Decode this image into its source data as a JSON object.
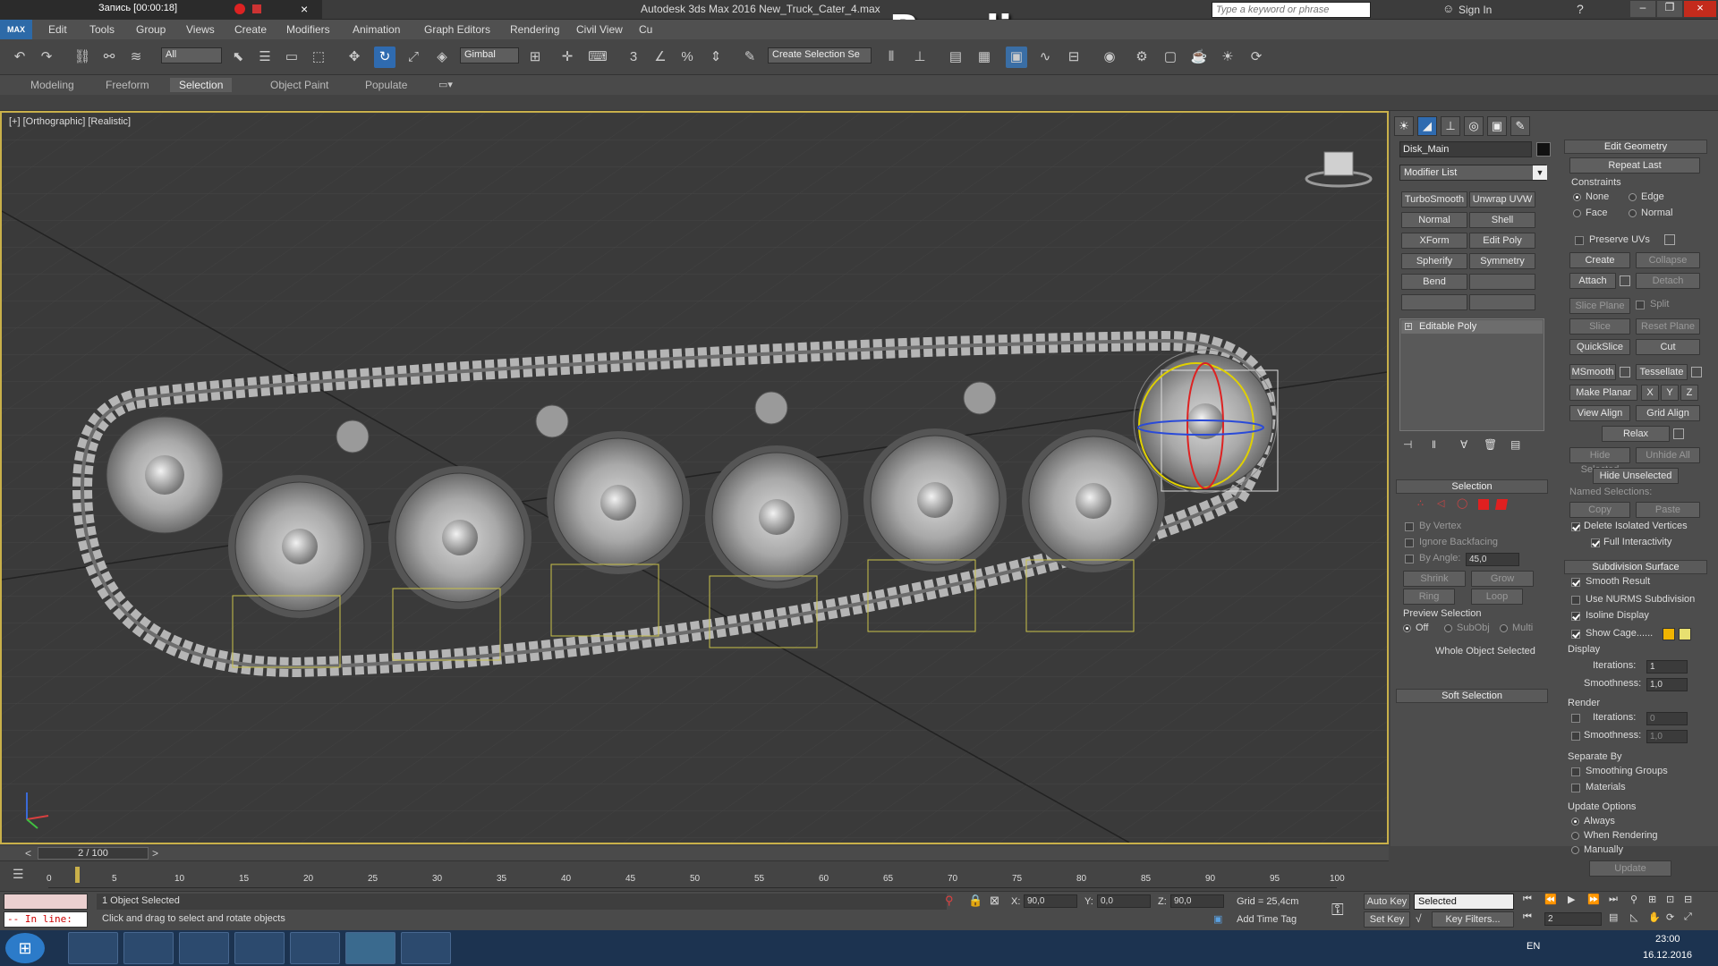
{
  "recorder": {
    "label": "Запись [00:00:18]"
  },
  "window": {
    "title": "Autodesk 3ds Max 2016     New_Truck_Cater_4.max"
  },
  "watermark": "www.Bandicam.com",
  "search": {
    "placeholder": "Type a keyword or phrase"
  },
  "signin": "Sign In",
  "menu": [
    "Edit",
    "Tools",
    "Group",
    "Views",
    "Create",
    "Modifiers",
    "Animation",
    "Graph Editors",
    "Rendering",
    "Civil View",
    "Cu"
  ],
  "app_logo": "MAX",
  "toolbar": {
    "filter": "All",
    "coord": "Gimbal",
    "selection_set": "Create Selection Se"
  },
  "ribbon_tabs": [
    "Modeling",
    "Freeform",
    "Selection",
    "Object Paint",
    "Populate"
  ],
  "ribbon_selected": "Selection",
  "viewport": {
    "label": "[+] [Orthographic] [Realistic]"
  },
  "panel": {
    "object_name": "Disk_Main",
    "modifier_list": "Modifier List",
    "mod_buttons": [
      [
        "TurboSmooth",
        "Unwrap UVW"
      ],
      [
        "Normal",
        "Shell"
      ],
      [
        "XForm",
        "Edit Poly"
      ],
      [
        "Spherify",
        "Symmetry"
      ],
      [
        "Bend",
        ""
      ],
      [
        "",
        ""
      ]
    ],
    "stack_item": "Editable Poly",
    "selection": {
      "title": "Selection",
      "by_vertex": "By Vertex",
      "ignore_backfacing": "Ignore Backfacing",
      "by_angle": "By Angle:",
      "angle_value": "45,0",
      "shrink": "Shrink",
      "grow": "Grow",
      "ring": "Ring",
      "loop": "Loop",
      "preview": "Preview Selection",
      "preview_opts": [
        "Off",
        "SubObj",
        "Multi"
      ],
      "status": "Whole Object Selected"
    },
    "soft_selection": "Soft Selection"
  },
  "edit_geometry": {
    "title": "Edit Geometry",
    "repeat_last": "Repeat Last",
    "constraints": "Constraints",
    "constraint_opts": [
      "None",
      "Edge",
      "Face",
      "Normal"
    ],
    "preserve_uvs": "Preserve UVs",
    "create": "Create",
    "collapse": "Collapse",
    "attach": "Attach",
    "detach": "Detach",
    "slice_plane": "Slice Plane",
    "split": "Split",
    "slice": "Slice",
    "reset_plane": "Reset Plane",
    "quickslice": "QuickSlice",
    "cut": "Cut",
    "msmooth": "MSmooth",
    "tessellate": "Tessellate",
    "make_planar": "Make Planar",
    "x": "X",
    "y": "Y",
    "z": "Z",
    "view_align": "View Align",
    "grid_align": "Grid Align",
    "relax": "Relax",
    "hide_selected": "Hide Selected",
    "unhide_all": "Unhide All",
    "hide_unselected": "Hide Unselected",
    "named_selections": "Named Selections:",
    "copy": "Copy",
    "paste": "Paste",
    "delete_isolated": "Delete Isolated Vertices",
    "full_interactivity": "Full Interactivity"
  },
  "subdivision": {
    "title": "Subdivision Surface",
    "smooth_result": "Smooth Result",
    "use_nurms": "Use NURMS Subdivision",
    "isoline": "Isoline Display",
    "show_cage": "Show Cage......",
    "cage_colors": [
      "#f0b400",
      "#e8e070"
    ],
    "display": "Display",
    "iterations_label": "Iterations:",
    "iterations": "1",
    "smoothness_label": "Smoothness:",
    "smoothness": "1,0",
    "render": "Render",
    "render_iterations": "0",
    "render_smoothness": "1,0",
    "separate_by": "Separate By",
    "smoothing_groups": "Smoothing Groups",
    "materials": "Materials",
    "update_options": "Update Options",
    "update_opts": [
      "Always",
      "When Rendering",
      "Manually"
    ],
    "update": "Update"
  },
  "timeline": {
    "frame": "2 / 100",
    "ticks": [
      "0",
      "5",
      "10",
      "15",
      "20",
      "25",
      "30",
      "35",
      "40",
      "45",
      "50",
      "55",
      "60",
      "65",
      "70",
      "75",
      "80",
      "85",
      "90",
      "95",
      "100"
    ]
  },
  "status": {
    "maxscript": "-- In line:",
    "selected": "1 Object Selected",
    "prompt": "Click and drag to select and rotate objects",
    "x_label": "X:",
    "x": "90,0",
    "y_label": "Y:",
    "y": "0,0",
    "z_label": "Z:",
    "z": "90,0",
    "grid": "Grid = 25,4cm",
    "add_time_tag": "Add Time Tag",
    "auto_key": "Auto Key",
    "set_key": "Set Key",
    "selected_dd": "Selected",
    "key_filters": "Key Filters...",
    "frame_field": "2"
  },
  "taskbar": {
    "lang": "EN",
    "time": "23:00",
    "date": "16.12.2016"
  }
}
